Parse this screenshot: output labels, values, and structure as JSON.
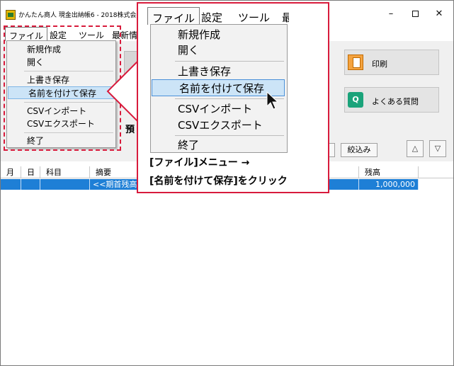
{
  "window": {
    "title": "かんたん商人 現金出納帳6 - 2018株式会",
    "controls": {
      "minimize": "–",
      "close": "✕"
    }
  },
  "menubar": {
    "file": "ファイル",
    "settings": "設定",
    "tools": "ツール",
    "latest": "最新情"
  },
  "toolbar": {
    "print_label": "印刷",
    "faq_label": "よくある質問",
    "faq_icon_glyph": "Q",
    "filter_label": "絞込み",
    "nav_up": "△",
    "nav_down": "▽",
    "partial_label": "預"
  },
  "file_menu": {
    "items": [
      {
        "label": "新規作成"
      },
      {
        "label": "開く"
      },
      {
        "label": "上書き保存"
      },
      {
        "label": "名前を付けて保存",
        "highlighted": true
      },
      {
        "label": "CSVインポート"
      },
      {
        "label": "CSVエクスポート"
      },
      {
        "label": "終了"
      }
    ]
  },
  "ledger": {
    "columns": [
      "月",
      "日",
      "科目",
      "摘要",
      "残高"
    ],
    "rows": [
      {
        "month": "",
        "day": "",
        "account": "",
        "description": "<<期首残高",
        "balance": "1,000,000",
        "selected": true
      }
    ]
  },
  "callout": {
    "menubar": {
      "file": "ファイル",
      "settings": "設定",
      "tools": "ツール",
      "latest": "最"
    },
    "items": [
      {
        "label": "新規作成"
      },
      {
        "label": "開く"
      },
      {
        "label": "上書き保存"
      },
      {
        "label": "名前を付けて保存",
        "highlighted": true
      },
      {
        "label": "CSVインポート"
      },
      {
        "label": "CSVエクスポート"
      },
      {
        "label": "終了"
      }
    ],
    "caption_line1": "[ファイル]メニュー →",
    "caption_line2": "[名前を付けて保存]をクリック"
  },
  "colors": {
    "annotation_red": "#d81b3c",
    "selection_blue": "#1e7fd6",
    "menu_highlight": "#cce4f7"
  }
}
